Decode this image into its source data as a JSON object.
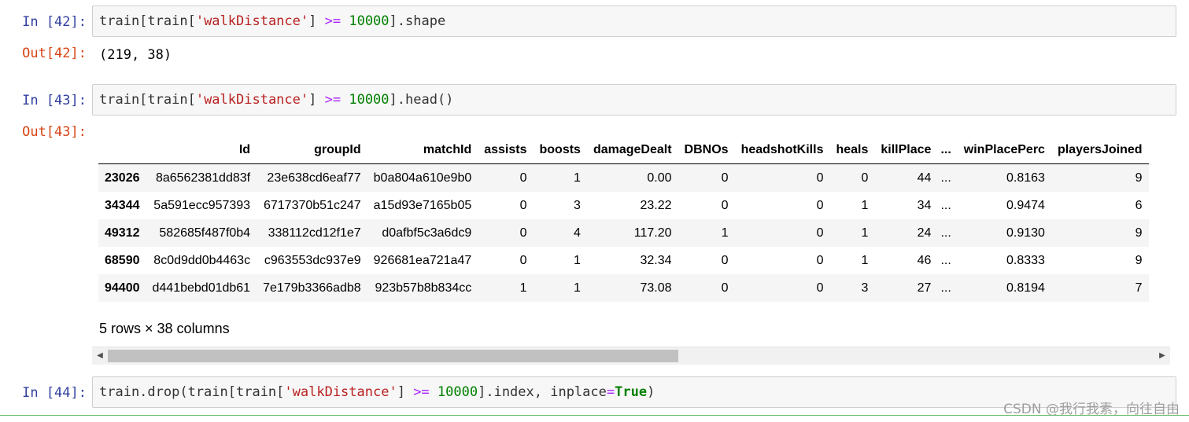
{
  "cells": [
    {
      "in_prompt": "In  [42]:",
      "code": {
        "p1": "train[train[",
        "s1": "'walkDistance'",
        "p2": "] ",
        "op": ">=",
        "sp": " ",
        "num": "10000",
        "p3": "].shape"
      },
      "out_prompt": "Out[42]:",
      "output": "(219, 38)"
    },
    {
      "in_prompt": "In  [43]:",
      "code": {
        "p1": "train[train[",
        "s1": "'walkDistance'",
        "p2": "] ",
        "op": ">=",
        "sp": " ",
        "num": "10000",
        "p3": "].head()"
      },
      "out_prompt": "Out[43]:"
    },
    {
      "in_prompt": "In  [44]:",
      "code": {
        "p1": "train.drop(train[train[",
        "s1": "'walkDistance'",
        "p2": "] ",
        "op": ">=",
        "sp": " ",
        "num": "10000",
        "p3": "].index, inplace",
        "eq": "=",
        "kw": "True",
        "p4": ")"
      }
    }
  ],
  "dataframe": {
    "columns": [
      "",
      "Id",
      "groupId",
      "matchId",
      "assists",
      "boosts",
      "damageDealt",
      "DBNOs",
      "headshotKills",
      "heals",
      "killPlace",
      "...",
      "winPlacePerc",
      "playersJoined"
    ],
    "rows": [
      [
        "23026",
        "8a6562381dd83f",
        "23e638cd6eaf77",
        "b0a804a610e9b0",
        "0",
        "1",
        "0.00",
        "0",
        "0",
        "0",
        "44",
        "...",
        "0.8163",
        "9"
      ],
      [
        "34344",
        "5a591ecc957393",
        "6717370b51c247",
        "a15d93e7165b05",
        "0",
        "3",
        "23.22",
        "0",
        "0",
        "1",
        "34",
        "...",
        "0.9474",
        "6"
      ],
      [
        "49312",
        "582685f487f0b4",
        "338112cd12f1e7",
        "d0afbf5c3a6dc9",
        "0",
        "4",
        "117.20",
        "1",
        "0",
        "1",
        "24",
        "...",
        "0.9130",
        "9"
      ],
      [
        "68590",
        "8c0d9dd0b4463c",
        "c963553dc937e9",
        "926681ea721a47",
        "0",
        "1",
        "32.34",
        "0",
        "0",
        "1",
        "46",
        "...",
        "0.8333",
        "9"
      ],
      [
        "94400",
        "d441bebd01db61",
        "7e179b3366adb8",
        "923b57b8b834cc",
        "1",
        "1",
        "73.08",
        "0",
        "0",
        "3",
        "27",
        "...",
        "0.8194",
        "7"
      ]
    ],
    "summary": "5 rows × 38 columns"
  },
  "scrollbar": {
    "left_arrow": "◀",
    "right_arrow": "▶",
    "position": 0.53
  },
  "watermark": "CSDN @我行我素，向往自由",
  "colors": {
    "in_prompt": "#303f9f",
    "out_prompt": "#d84315",
    "string": "#ba2121",
    "operator": "#aa22ff",
    "number": "#008000",
    "keyword": "#008000"
  }
}
